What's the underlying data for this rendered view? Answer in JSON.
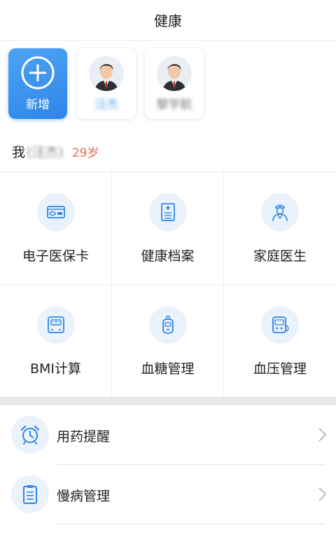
{
  "header": {
    "title": "健康"
  },
  "members": {
    "add_label": "新增",
    "people": [
      {
        "name": "汪杰"
      },
      {
        "name": "黎宇航"
      }
    ]
  },
  "me": {
    "label": "我",
    "name": "(汪杰)",
    "age": "29岁"
  },
  "grid": [
    {
      "label": "电子医保卡",
      "icon": "insurance-card-icon"
    },
    {
      "label": "健康档案",
      "icon": "health-record-icon"
    },
    {
      "label": "家庭医生",
      "icon": "doctor-icon"
    },
    {
      "label": "BMI计算",
      "icon": "scale-icon"
    },
    {
      "label": "血糖管理",
      "icon": "glucose-meter-icon"
    },
    {
      "label": "血压管理",
      "icon": "blood-pressure-icon"
    }
  ],
  "list": [
    {
      "label": "用药提醒",
      "icon": "alarm-clock-icon"
    },
    {
      "label": "慢病管理",
      "icon": "clipboard-icon"
    }
  ],
  "colors": {
    "accent": "#2f86e8",
    "icon_bg": "#eaf2fb",
    "age": "#e46a4c"
  }
}
